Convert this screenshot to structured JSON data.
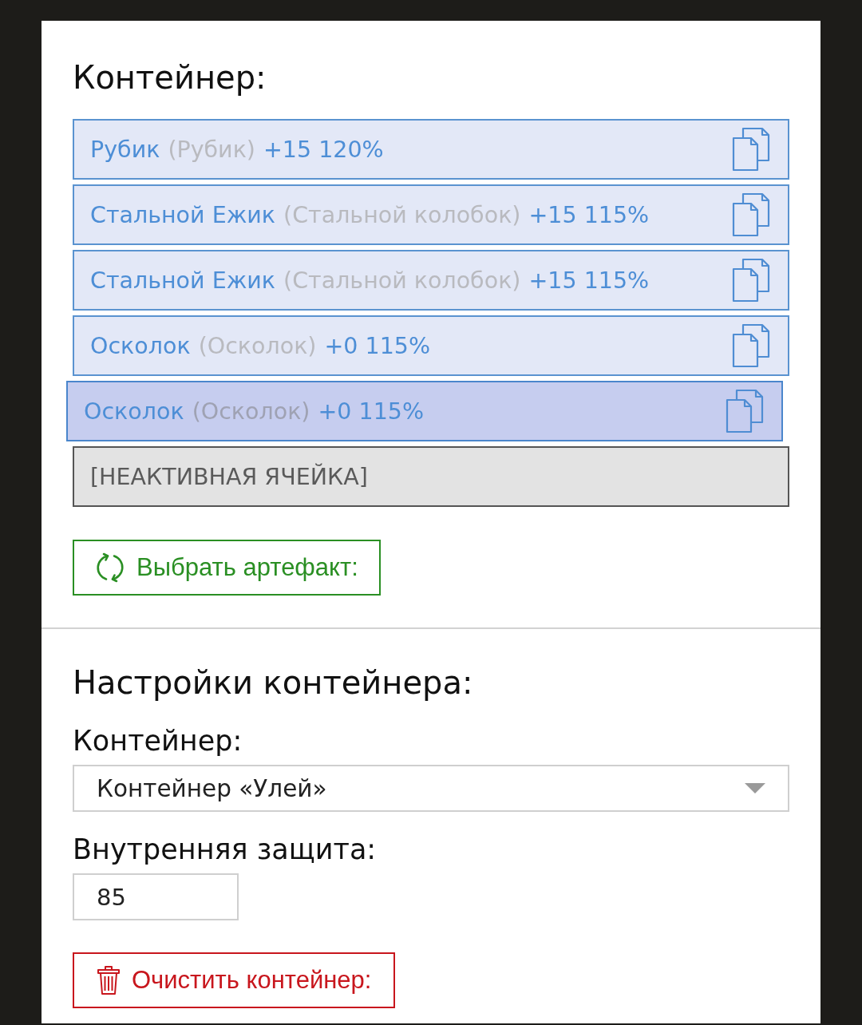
{
  "container_section": {
    "title": "Контейнер:",
    "slots": [
      {
        "kind": "artifact",
        "name": "Рубик",
        "original": "(Рубик)",
        "stats": "+15 120%",
        "selected": false
      },
      {
        "kind": "artifact",
        "name": "Стальной Ежик",
        "original": "(Стальной колобок)",
        "stats": "+15 115%",
        "selected": false
      },
      {
        "kind": "artifact",
        "name": "Стальной Ежик",
        "original": "(Стальной колобок)",
        "stats": "+15 115%",
        "selected": false
      },
      {
        "kind": "artifact",
        "name": "Осколок",
        "original": "(Осколок)",
        "stats": "+0 115%",
        "selected": false
      },
      {
        "kind": "artifact",
        "name": "Осколок",
        "original": "(Осколок)",
        "stats": "+0 115%",
        "selected": true
      },
      {
        "kind": "inactive",
        "label": "[НЕАКТИВНАЯ ЯЧЕЙКА]",
        "selected": false
      }
    ],
    "choose_button": {
      "label": "Выбрать артефакт:"
    }
  },
  "settings_section": {
    "title": "Настройки контейнера:",
    "container_field": {
      "label": "Контейнер:",
      "value": "Контейнер «Улей»"
    },
    "protection_field": {
      "label": "Внутренняя защита:",
      "value": "85"
    },
    "clear_button": {
      "label": "Очистить контейнер:"
    }
  }
}
